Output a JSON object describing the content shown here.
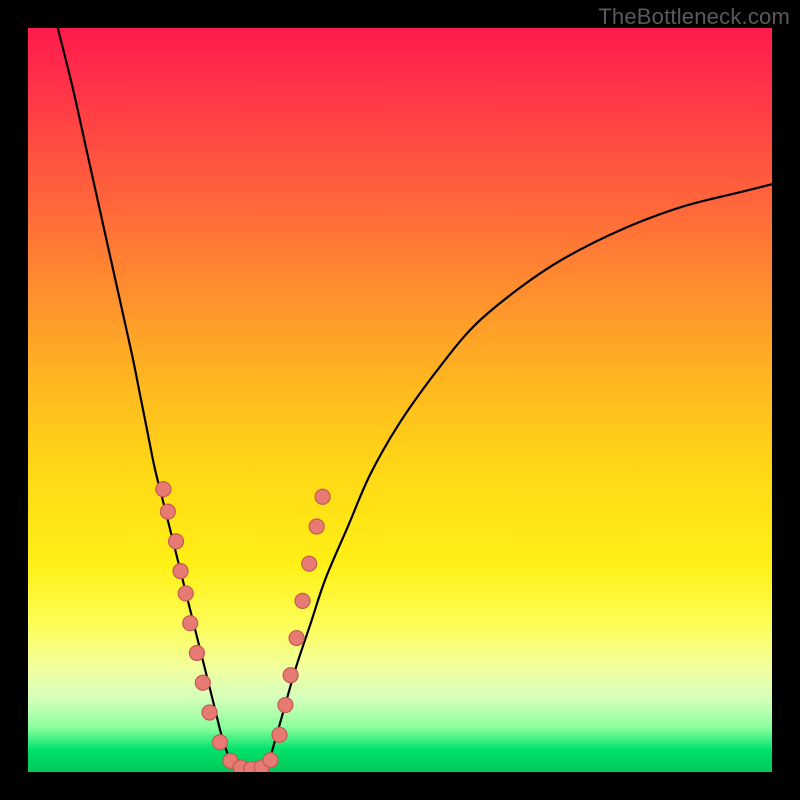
{
  "watermark": "TheBottleneck.com",
  "chart_data": {
    "type": "line",
    "title": "",
    "xlabel": "",
    "ylabel": "",
    "xlim": [
      0,
      100
    ],
    "ylim": [
      0,
      100
    ],
    "grid": false,
    "series": [
      {
        "name": "left-curve",
        "x": [
          4,
          6,
          8,
          10,
          12,
          14,
          15,
          16,
          17,
          18,
          19,
          20,
          21,
          22,
          23,
          24,
          25,
          26,
          27,
          28
        ],
        "y": [
          100,
          92,
          83,
          74,
          65,
          56,
          51,
          46,
          41,
          37,
          33,
          29,
          25,
          21,
          17,
          13,
          9,
          5,
          2,
          0
        ]
      },
      {
        "name": "valley-floor",
        "x": [
          28,
          29,
          30,
          31,
          32
        ],
        "y": [
          0,
          0,
          0,
          0,
          0
        ]
      },
      {
        "name": "right-curve",
        "x": [
          32,
          34,
          36,
          38,
          40,
          43,
          46,
          50,
          55,
          60,
          66,
          72,
          80,
          88,
          96,
          100
        ],
        "y": [
          0,
          7,
          14,
          20,
          26,
          33,
          40,
          47,
          54,
          60,
          65,
          69,
          73,
          76,
          78,
          79
        ]
      }
    ],
    "scatter": [
      {
        "name": "left-dots",
        "points": [
          [
            18.2,
            38
          ],
          [
            18.8,
            35
          ],
          [
            19.9,
            31
          ],
          [
            20.5,
            27
          ],
          [
            21.2,
            24
          ],
          [
            21.8,
            20
          ],
          [
            22.7,
            16
          ],
          [
            23.5,
            12
          ],
          [
            24.4,
            8
          ],
          [
            25.8,
            4
          ],
          [
            27.2,
            1.5
          ],
          [
            28.6,
            0.6
          ],
          [
            30.0,
            0.4
          ],
          [
            31.4,
            0.6
          ],
          [
            32.6,
            1.6
          ]
        ]
      },
      {
        "name": "right-dots",
        "points": [
          [
            33.8,
            5
          ],
          [
            34.6,
            9
          ],
          [
            35.3,
            13
          ],
          [
            36.1,
            18
          ],
          [
            36.9,
            23
          ],
          [
            37.8,
            28
          ],
          [
            38.8,
            33
          ],
          [
            39.6,
            37
          ]
        ]
      }
    ],
    "background_gradient": {
      "top": "#ff1a4d",
      "mid": "#ffd916",
      "bottom": "#00c85a"
    }
  }
}
